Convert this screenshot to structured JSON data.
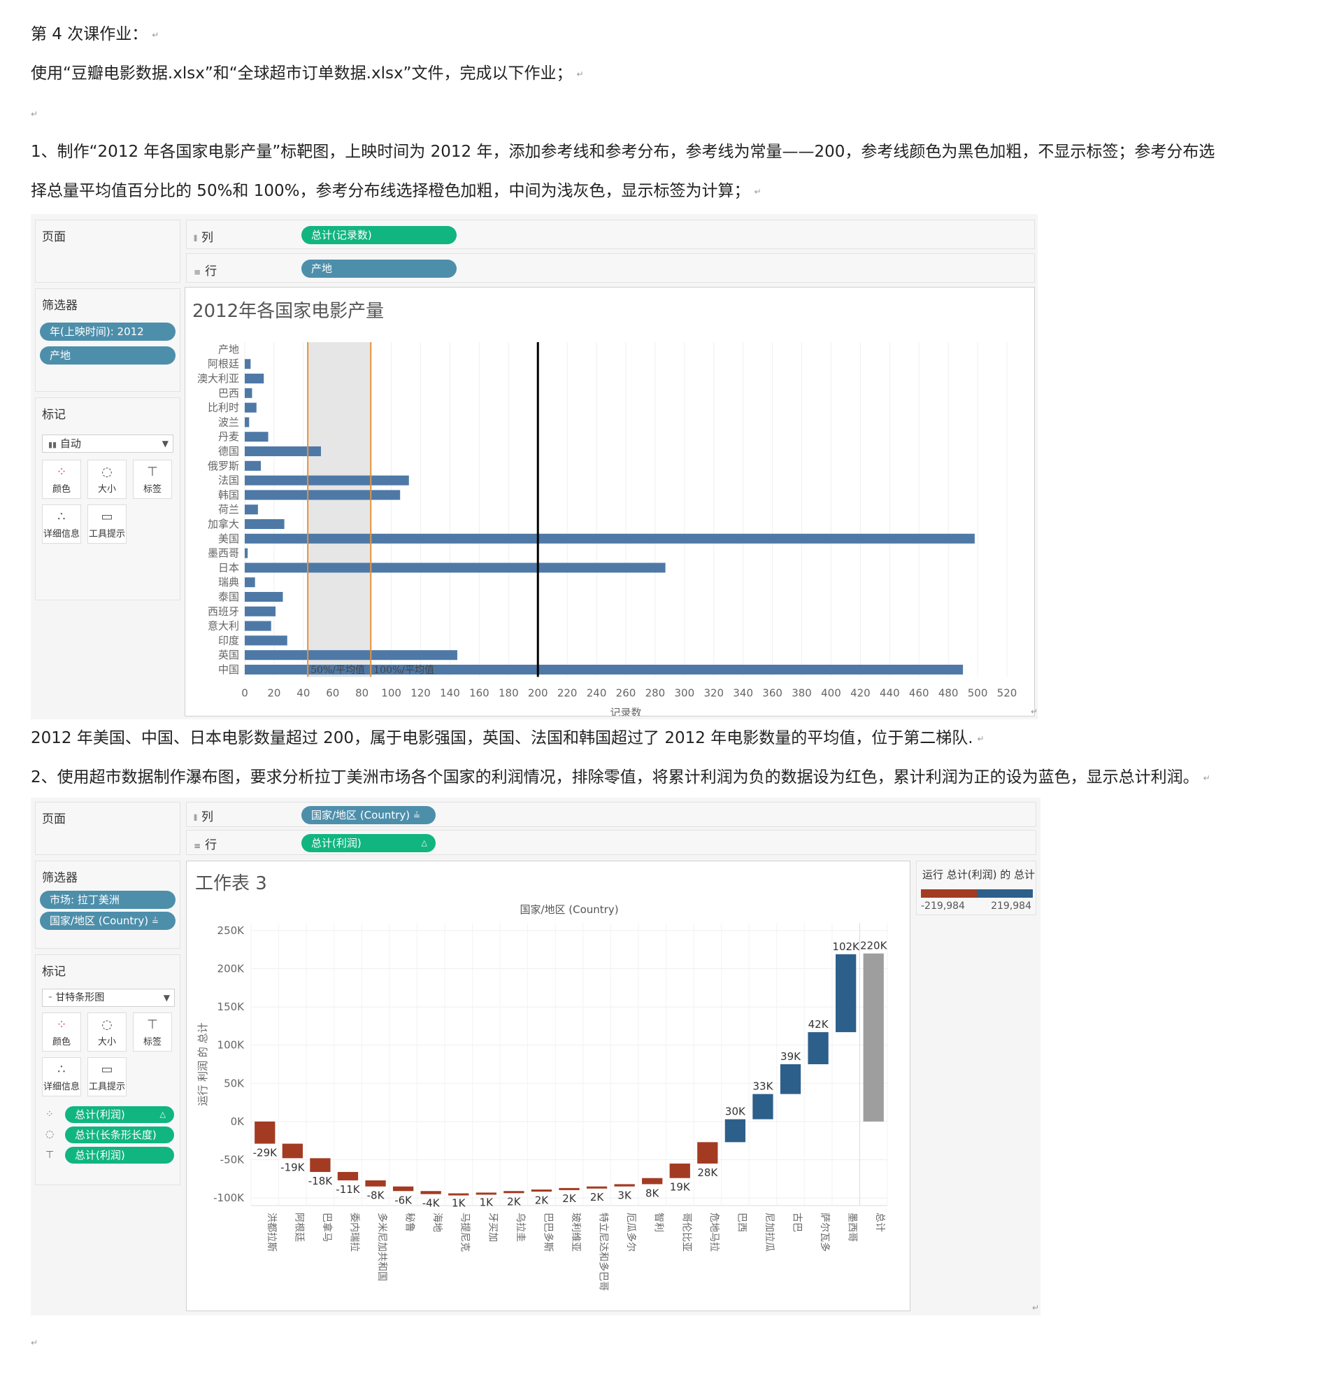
{
  "doc": {
    "line1": "第 4 次课作业：",
    "line2": "使用“豆瓣电影数据.xlsx”和“全球超市订单数据.xlsx”文件，完成以下作业；",
    "task1a": "1、制作“2012 年各国家电影产量”标靶图，上映时间为 2012 年，添加参考线和参考分布，参考线为常量——200，参考线颜色为黑色加粗，不显示标签；参考分布选",
    "task1b": "择总量平均值百分比的 50%和 100%，参考分布线选择橙色加粗，中间为浅灰色，显示标签为计算；",
    "conclusion": "2012 年美国、中国、日本电影数量超过 200，属于电影强国，英国、法国和韩国超过了 2012 年电影数量的平均值，位于第二梯队.",
    "task2": "2、使用超市数据制作瀑布图，要求分析拉丁美洲市场各个国家的利润情况，排除零值，将累计利润为负的数据设为红色，累计利润为正的设为蓝色，显示总计利润。",
    "para_mark": "↵"
  },
  "ws1": {
    "pages_label": "页面",
    "columns_label": "列",
    "rows_label": "行",
    "columns_pill": "总计(记录数)",
    "rows_pill": "产地",
    "filters_label": "筛选器",
    "filters": [
      "年(上映时间): 2012",
      "产地"
    ],
    "marks_label": "标记",
    "mark_type": "自动",
    "mark_buttons": [
      "颜色",
      "大小",
      "标签",
      "详细信息",
      "工具提示"
    ]
  },
  "ws2": {
    "pages_label": "页面",
    "columns_label": "列",
    "rows_label": "行",
    "columns_pill": "国家/地区 (Country)",
    "rows_pill": "总计(利润)",
    "filters_label": "筛选器",
    "filters": [
      "市场: 拉丁美洲",
      "国家/地区 (Country)"
    ],
    "marks_label": "标记",
    "mark_type": "甘特条形图",
    "mark_buttons": [
      "颜色",
      "大小",
      "标签",
      "详细信息",
      "工具提示"
    ],
    "mark_pills": [
      "总计(利润)",
      "总计(长条形长度)",
      "总计(利润)"
    ],
    "legend_title": "运行 总计(利润) 的 总计",
    "legend_min": "-219,984",
    "legend_max": "219,984"
  },
  "chart_data": [
    {
      "type": "bar",
      "title": "2012年各国家电影产量",
      "orientation": "horizontal",
      "row_header": "产地",
      "categories": [
        "阿根廷",
        "澳大利亚",
        "巴西",
        "比利时",
        "波兰",
        "丹麦",
        "德国",
        "俄罗斯",
        "法国",
        "韩国",
        "荷兰",
        "加拿大",
        "美国",
        "墨西哥",
        "日本",
        "瑞典",
        "泰国",
        "西班牙",
        "意大利",
        "印度",
        "英国",
        "中国"
      ],
      "values": [
        4,
        13,
        5,
        8,
        3,
        16,
        52,
        11,
        112,
        106,
        9,
        27,
        498,
        2,
        287,
        7,
        26,
        21,
        18,
        29,
        145,
        490
      ],
      "xlabel": "记录数",
      "xlim": [
        0,
        520
      ],
      "xticks": [
        0,
        20,
        40,
        60,
        80,
        100,
        120,
        140,
        160,
        180,
        200,
        220,
        240,
        260,
        280,
        300,
        320,
        340,
        360,
        380,
        400,
        420,
        440,
        460,
        480,
        500,
        520
      ],
      "reference_line": {
        "value": 200,
        "color": "#000000"
      },
      "reference_band": {
        "from": 43,
        "to": 86,
        "line_color": "#e8923a",
        "fill": "#e6e6e6",
        "labels": [
          "50%/平均值",
          "100%/平均值"
        ]
      },
      "bar_color": "#4e79a7"
    },
    {
      "type": "waterfall",
      "title": "工作表 3",
      "header": "国家/地区 (Country)",
      "ylabel": "运行 利润 的 总计",
      "ylim": [
        -110000,
        260000
      ],
      "yticks": [
        250000,
        200000,
        150000,
        100000,
        50000,
        0,
        -50000,
        -100000
      ],
      "ytick_labels": [
        "250K",
        "200K",
        "150K",
        "100K",
        "50K",
        "0K",
        "-50K",
        "-100K"
      ],
      "categories": [
        "洪都拉斯",
        "阿根廷",
        "巴拿马",
        "委内瑞拉",
        "多米尼加共和国",
        "秘鲁",
        "海地",
        "马提尼克",
        "牙买加",
        "乌拉圭",
        "巴巴多斯",
        "玻利维亚",
        "特立尼达和多巴哥",
        "厄瓜多尔",
        "智利",
        "哥伦比亚",
        "危地马拉",
        "巴西",
        "尼加拉瓜",
        "古巴",
        "萨尔瓦多",
        "墨西哥",
        "总计"
      ],
      "values": [
        -29000,
        -19000,
        -18000,
        -11000,
        -8000,
        -6000,
        -4000,
        1000,
        1000,
        2000,
        2000,
        2000,
        2000,
        3000,
        8000,
        19000,
        28000,
        30000,
        33000,
        39000,
        42000,
        102000,
        220000
      ],
      "labels": [
        "-29K",
        "-19K",
        "-18K",
        "-11K",
        "-8K",
        "-6K",
        "-4K",
        "1K",
        "1K",
        "2K",
        "2K",
        "2K",
        "2K",
        "3K",
        "8K",
        "19K",
        "28K",
        "30K",
        "33K",
        "39K",
        "42K",
        "102K",
        "220K"
      ],
      "colors": {
        "negative": "#a33b22",
        "positive": "#2d5f8b",
        "total": "#9e9e9e"
      }
    }
  ]
}
